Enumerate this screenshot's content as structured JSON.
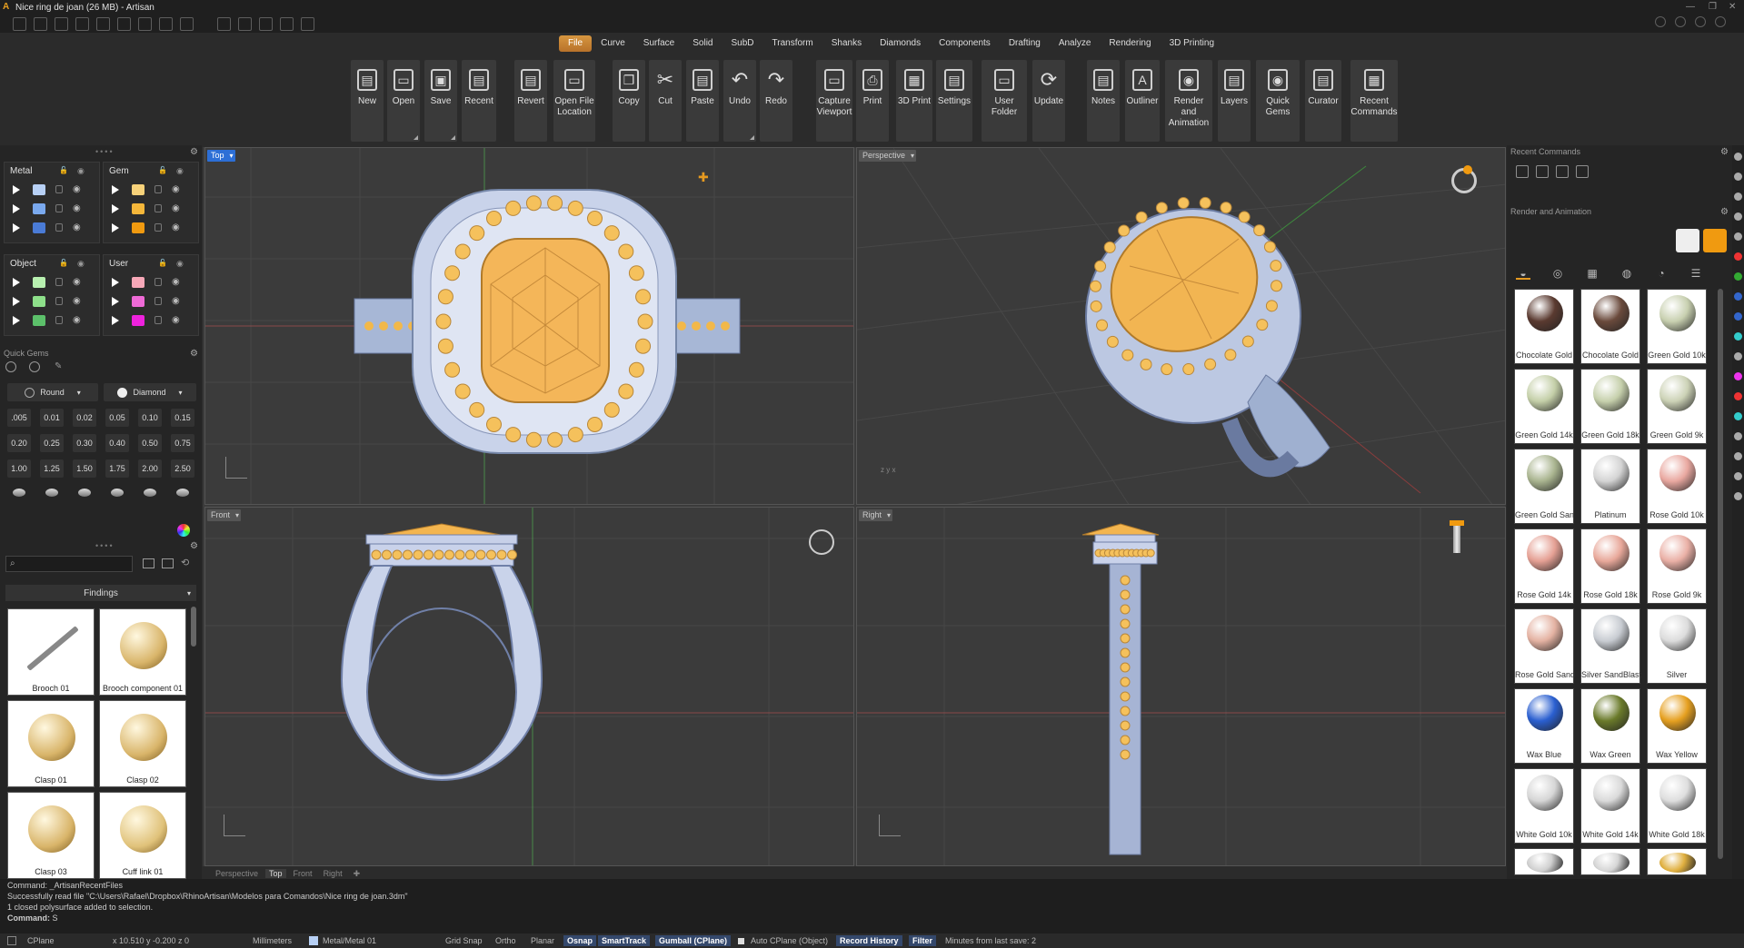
{
  "window": {
    "title": "Nice ring de joan (26 MB) - Artisan",
    "logo": "A"
  },
  "menu_tabs": [
    "File",
    "Curve",
    "Surface",
    "Solid",
    "SubD",
    "Transform",
    "Shanks",
    "Diamonds",
    "Components",
    "Drafting",
    "Analyze",
    "Rendering",
    "3D Printing"
  ],
  "active_tab": "File",
  "ribbon": [
    {
      "label": "New",
      "icon": "new-file-icon"
    },
    {
      "label": "Open",
      "icon": "folder-open-icon"
    },
    {
      "label": "Save",
      "icon": "save-icon"
    },
    {
      "label": "Recent",
      "icon": "recent-icon"
    },
    {
      "label": "Revert",
      "icon": "revert-icon"
    },
    {
      "label": "Open File Location",
      "icon": "folder-search-icon"
    },
    {
      "label": "Copy",
      "icon": "copy-icon"
    },
    {
      "label": "Cut",
      "icon": "scissors-icon"
    },
    {
      "label": "Paste",
      "icon": "paste-icon"
    },
    {
      "label": "Undo",
      "icon": "undo-icon"
    },
    {
      "label": "Redo",
      "icon": "redo-icon"
    },
    {
      "label": "Capture Viewport",
      "icon": "monitor-icon"
    },
    {
      "label": "Print",
      "icon": "printer-icon"
    },
    {
      "label": "3D Print",
      "icon": "3d-printer-icon"
    },
    {
      "label": "Settings",
      "icon": "settings-icon"
    },
    {
      "label": "User Folder",
      "icon": "user-folder-icon"
    },
    {
      "label": "Update",
      "icon": "refresh-icon"
    },
    {
      "label": "Notes",
      "icon": "notes-icon"
    },
    {
      "label": "Outliner",
      "icon": "outliner-icon"
    },
    {
      "label": "Render and Animation",
      "icon": "render-icon"
    },
    {
      "label": "Layers",
      "icon": "layers-icon"
    },
    {
      "label": "Quick Gems",
      "icon": "gem-icon"
    },
    {
      "label": "Curator",
      "icon": "curator-icon"
    },
    {
      "label": "Recent Commands",
      "icon": "recent-commands-icon"
    }
  ],
  "layers": {
    "groups": [
      {
        "name": "Metal",
        "colors": [
          "#b7d0f5",
          "#7aa9ee",
          "#4a7bd6"
        ]
      },
      {
        "name": "Gem",
        "colors": [
          "#f7d27a",
          "#f5b73a",
          "#f09a10"
        ]
      },
      {
        "name": "Object",
        "colors": [
          "#b8f0b0",
          "#8ee08a",
          "#5cc06a"
        ]
      },
      {
        "name": "User",
        "colors": [
          "#f7a8b8",
          "#ee6ad6",
          "#ee22dd"
        ]
      }
    ]
  },
  "quick_gems": {
    "title": "Quick Gems",
    "cut": "Round",
    "material": "Diamond",
    "sizes": [
      ".005",
      "0.01",
      "0.02",
      "0.05",
      "0.10",
      "0.15",
      "0.20",
      "0.25",
      "0.30",
      "0.40",
      "0.50",
      "0.75",
      "1.00",
      "1.25",
      "1.50",
      "1.75",
      "2.00",
      "2.50"
    ]
  },
  "findings": {
    "category": "Findings",
    "items": [
      "Brooch 01",
      "Brooch component 01",
      "Clasp 01",
      "Clasp 02",
      "Clasp 03",
      "Cuff link 01"
    ]
  },
  "viewports": [
    {
      "name": "Top",
      "active": true
    },
    {
      "name": "Perspective",
      "active": false
    },
    {
      "name": "Front",
      "active": false
    },
    {
      "name": "Right",
      "active": false
    }
  ],
  "viewport_tabs": [
    "Perspective",
    "Top",
    "Front",
    "Right"
  ],
  "active_viewport_tab": "Top",
  "command_history": [
    "Command: _ArtisanRecentFiles",
    "Successfully read file \"C:\\Users\\Rafael\\Dropbox\\RhinoArtisan\\Modelos para Comandos\\Nice ring de joan.3dm\"",
    "1 closed polysurface added to selection."
  ],
  "command_prompt": {
    "label": "Command:",
    "value": "S"
  },
  "statusbar": {
    "cplane": "CPlane",
    "coords": "x 10.510  y -0.200  z 0",
    "units": "Millimeters",
    "layer": "Metal/Metal 01",
    "grid_snap": "Grid Snap",
    "ortho": "Ortho",
    "planar": "Planar",
    "osnap": "Osnap",
    "smarttrack": "SmartTrack",
    "gumball": "Gumball (CPlane)",
    "autocplane": "Auto CPlane (Object)",
    "record_history": "Record History",
    "filter": "Filter",
    "last_save": "Minutes from last save: 2"
  },
  "right_panel": {
    "recent_commands_title": "Recent Commands",
    "render_title": "Render and Animation",
    "materials": [
      {
        "name": "Chocolate Gold",
        "color": "#5a3a30"
      },
      {
        "name": "Chocolate Gold",
        "color": "#6a4a3c"
      },
      {
        "name": "Green Gold 10k",
        "color": "#c8d0b0"
      },
      {
        "name": "Green Gold 14k",
        "color": "#c4cfa8"
      },
      {
        "name": "Green Gold 18k",
        "color": "#c6d0ac"
      },
      {
        "name": "Green Gold 9k",
        "color": "#ccd2b6"
      },
      {
        "name": "Green Gold San",
        "color": "#a9b48f"
      },
      {
        "name": "Platinum",
        "color": "#d4d4d4"
      },
      {
        "name": "Rose Gold 10k",
        "color": "#e9a8a0"
      },
      {
        "name": "Rose Gold 14k",
        "color": "#e5a094"
      },
      {
        "name": "Rose Gold 18k",
        "color": "#e8a89a"
      },
      {
        "name": "Rose Gold 9k",
        "color": "#eab0a6"
      },
      {
        "name": "Rose Gold Sand",
        "color": "#e4b2a2"
      },
      {
        "name": "Silver SandBlast",
        "color": "#c8ccd2"
      },
      {
        "name": "Silver",
        "color": "#dcdcdc"
      },
      {
        "name": "Wax Blue",
        "color": "#2a5fd0"
      },
      {
        "name": "Wax Green",
        "color": "#6a7a2a"
      },
      {
        "name": "Wax Yellow",
        "color": "#e6a020"
      },
      {
        "name": "White Gold 10k",
        "color": "#d6d6d6"
      },
      {
        "name": "White Gold 14k",
        "color": "#dadada"
      },
      {
        "name": "White Gold 18k",
        "color": "#dedede"
      },
      {
        "name": "",
        "color": "#d0d0d0"
      },
      {
        "name": "",
        "color": "#d6d6d6"
      },
      {
        "name": "",
        "color": "#e0b040"
      }
    ]
  }
}
